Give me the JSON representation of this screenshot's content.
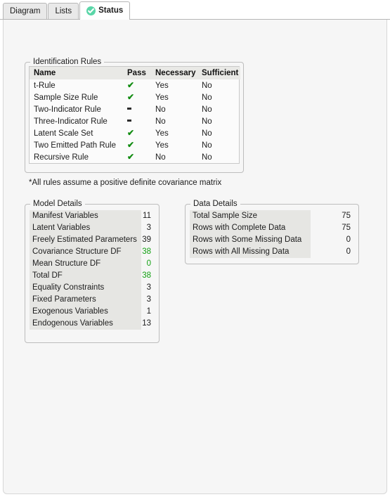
{
  "window": {
    "tabs": [
      {
        "label": "Diagram",
        "active": false,
        "icon": null
      },
      {
        "label": "Lists",
        "active": false,
        "icon": null
      },
      {
        "label": "Status",
        "active": true,
        "icon": "green-check-circle-icon"
      }
    ]
  },
  "identification_rules": {
    "title": "Identification Rules",
    "columns": [
      "Name",
      "Pass",
      "Necessary",
      "Sufficient"
    ],
    "rows": [
      {
        "name": "t-Rule",
        "pass": "check",
        "necessary": "Yes",
        "sufficient": "No"
      },
      {
        "name": "Sample Size Rule",
        "pass": "check",
        "necessary": "Yes",
        "sufficient": "No"
      },
      {
        "name": "Two-Indicator Rule",
        "pass": "dash",
        "necessary": "No",
        "sufficient": "No"
      },
      {
        "name": "Three-Indicator Rule",
        "pass": "dash",
        "necessary": "No",
        "sufficient": "No"
      },
      {
        "name": "Latent Scale Set",
        "pass": "check",
        "necessary": "Yes",
        "sufficient": "No"
      },
      {
        "name": "Two Emitted Path Rule",
        "pass": "check",
        "necessary": "Yes",
        "sufficient": "No"
      },
      {
        "name": "Recursive Rule",
        "pass": "check",
        "necessary": "No",
        "sufficient": "No"
      }
    ],
    "footnote": "*All rules assume a positive definite covariance matrix"
  },
  "model_details": {
    "title": "Model Details",
    "rows": [
      {
        "label": "Manifest Variables",
        "value": "11",
        "green": false
      },
      {
        "label": "Latent Variables",
        "value": "3",
        "green": false
      },
      {
        "label": "Freely Estimated Parameters",
        "value": "39",
        "green": false
      },
      {
        "label": "Covariance Structure DF",
        "value": "38",
        "green": true
      },
      {
        "label": "Mean Structure DF",
        "value": "0",
        "green": true
      },
      {
        "label": "Total DF",
        "value": "38",
        "green": true
      },
      {
        "label": "Equality Constraints",
        "value": "3",
        "green": false
      },
      {
        "label": "Fixed Parameters",
        "value": "3",
        "green": false
      },
      {
        "label": "Exogenous Variables",
        "value": "1",
        "green": false
      },
      {
        "label": "Endogenous Variables",
        "value": "13",
        "green": false
      }
    ]
  },
  "data_details": {
    "title": "Data Details",
    "rows": [
      {
        "label": "Total Sample Size",
        "value": "75",
        "green": false
      },
      {
        "label": "Rows with Complete Data",
        "value": "75",
        "green": false
      },
      {
        "label": "Rows with Some Missing Data",
        "value": "0",
        "green": false
      },
      {
        "label": "Rows with All Missing Data",
        "value": "0",
        "green": false
      }
    ]
  },
  "colors": {
    "accent_green": "#12a012",
    "tab_check_circle": "#5ad6a8",
    "panel_background": "#f6f6f6",
    "label_band": "#e6e6e3",
    "table_header": "#e9e9e6"
  }
}
